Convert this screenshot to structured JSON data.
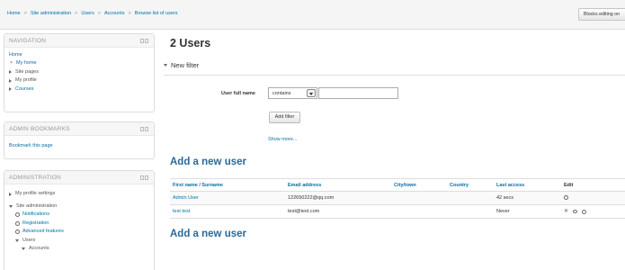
{
  "breadcrumb": [
    "Home",
    "Site administration",
    "Users",
    "Accounts",
    "Browse list of users"
  ],
  "blocks_editing_label": "Blocks editing on",
  "navigation": {
    "title": "NAVIGATION",
    "home": "Home",
    "items": [
      "My home",
      "Site pages",
      "My profile",
      "Courses"
    ]
  },
  "admin_bookmarks": {
    "title": "ADMIN BOOKMARKS",
    "bookmark_link": "Bookmark this page"
  },
  "administration": {
    "title": "ADMINISTRATION",
    "my_profile_settings": "My profile settings",
    "site_administration": "Site administration",
    "sub_items": [
      "Notifications",
      "Registration",
      "Advanced features"
    ],
    "users": "Users",
    "accounts": "Accounts"
  },
  "main": {
    "title": "2 Users",
    "new_filter": "New filter",
    "filter_label": "User full name",
    "filter_select": "contains",
    "filter_value": "",
    "add_filter": "Add filter",
    "show_more": "Show more...",
    "add_user_heading": "Add a new user"
  },
  "table": {
    "headers": [
      "First name / Surname",
      "Email address",
      "City/town",
      "Country",
      "Last access",
      "Edit"
    ],
    "rows": [
      {
        "name": "Admin User",
        "email": "122650222@qq.com",
        "city": "",
        "country": "",
        "last_access": "42 secs",
        "edit_icons": [
          "gear-icon"
        ]
      },
      {
        "name": "test test",
        "email": "test@test.com",
        "city": "",
        "country": "",
        "last_access": "Never",
        "edit_icons": [
          "delete-icon",
          "eye-icon",
          "gear-icon"
        ]
      }
    ]
  },
  "colors": {
    "link": "#0070a8",
    "heading_blue": "#2a6a9a"
  }
}
